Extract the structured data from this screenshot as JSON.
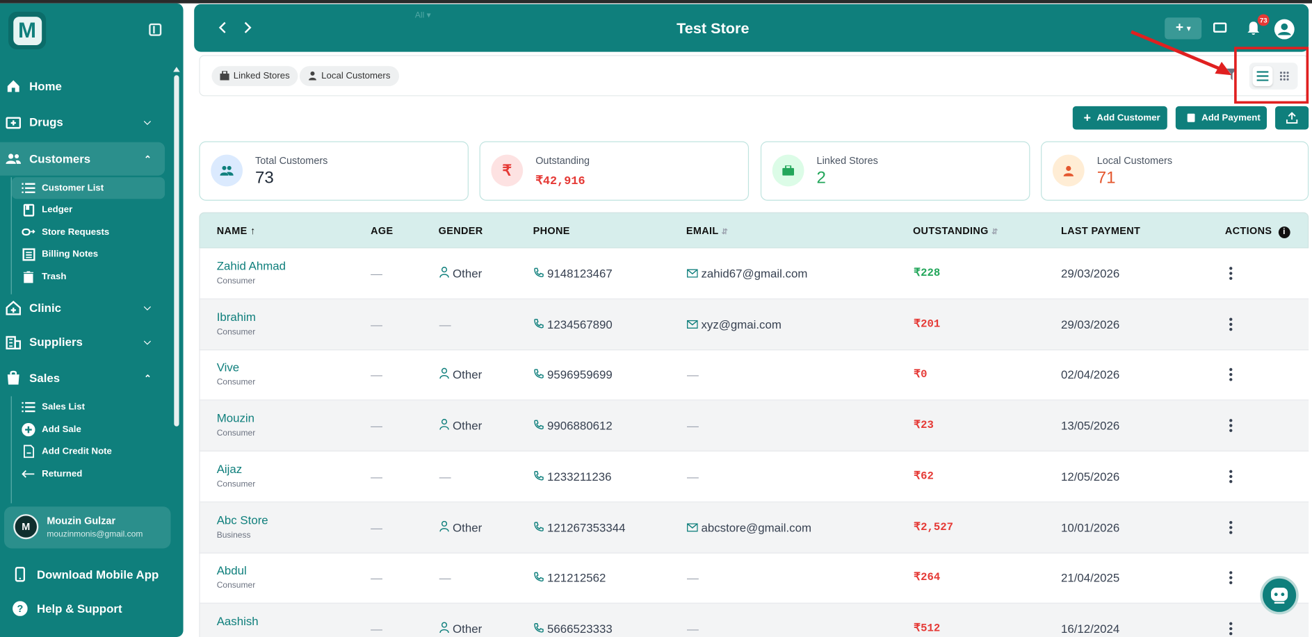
{
  "sidebar": {
    "logo_letter": "M",
    "nav": [
      {
        "label": "Home",
        "icon": "home-icon"
      },
      {
        "label": "Drugs",
        "icon": "drugs-icon"
      },
      {
        "label": "Customers",
        "icon": "customers-icon"
      },
      {
        "label": "Clinic",
        "icon": "clinic-icon"
      },
      {
        "label": "Suppliers",
        "icon": "suppliers-icon"
      },
      {
        "label": "Sales",
        "icon": "sales-icon"
      }
    ],
    "customers_sub": [
      {
        "label": "Customer List"
      },
      {
        "label": "Ledger"
      },
      {
        "label": "Store Requests"
      },
      {
        "label": "Billing Notes"
      },
      {
        "label": "Trash"
      }
    ],
    "sales_sub": [
      {
        "label": "Sales List"
      },
      {
        "label": "Add Sale"
      },
      {
        "label": "Add Credit Note"
      },
      {
        "label": "Returned"
      }
    ],
    "user": {
      "initial": "M",
      "name": "Mouzin Gulzar",
      "email": "mouzinmonis@gmail.com"
    },
    "download_app": "Download Mobile App",
    "help": "Help & Support"
  },
  "header": {
    "title": "Test Store",
    "ghost_text": "All",
    "notification_count": "73"
  },
  "filters": {
    "chips": [
      "Linked Stores",
      "Local Customers"
    ]
  },
  "actions": {
    "add_customer": "Add Customer",
    "add_payment": "Add Payment"
  },
  "stats": [
    {
      "label": "Total Customers",
      "value": "73",
      "color": "#1f2937"
    },
    {
      "label": "Outstanding",
      "value": "₹42,916",
      "color": "#e53935"
    },
    {
      "label": "Linked Stores",
      "value": "2",
      "color": "#22a65a"
    },
    {
      "label": "Local Customers",
      "value": "71",
      "color": "#e4572e"
    }
  ],
  "table": {
    "columns": [
      "NAME",
      "AGE",
      "GENDER",
      "PHONE",
      "EMAIL",
      "OUTSTANDING",
      "LAST PAYMENT",
      "ACTIONS"
    ],
    "rows": [
      {
        "name": "Zahid Ahmad",
        "type": "Consumer",
        "age": "—",
        "gender": "Other",
        "phone": "9148123467",
        "email": "zahid67@gmail.com",
        "outstanding": "₹228",
        "last_payment": "29/03/2026"
      },
      {
        "name": "Ibrahim",
        "type": "Consumer",
        "age": "—",
        "gender": "—",
        "phone": "1234567890",
        "email": "xyz@gmai.com",
        "outstanding": "₹201",
        "last_payment": "29/03/2026"
      },
      {
        "name": "Vive",
        "type": "Consumer",
        "age": "—",
        "gender": "Other",
        "phone": "9596959699",
        "email": "—",
        "outstanding": "₹0",
        "last_payment": "02/04/2026"
      },
      {
        "name": "Mouzin",
        "type": "Consumer",
        "age": "—",
        "gender": "Other",
        "phone": "9906880612",
        "email": "—",
        "outstanding": "₹23",
        "last_payment": "13/05/2026"
      },
      {
        "name": "Aijaz",
        "type": "Consumer",
        "age": "—",
        "gender": "—",
        "phone": "1233211236",
        "email": "—",
        "outstanding": "₹62",
        "last_payment": "12/05/2026"
      },
      {
        "name": "Abc Store",
        "type": "Business",
        "age": "—",
        "gender": "Other",
        "phone": "121267353344",
        "email": "abcstore@gmail.com",
        "outstanding": "₹2,527",
        "last_payment": "10/01/2026"
      },
      {
        "name": "Abdul",
        "type": "Consumer",
        "age": "—",
        "gender": "—",
        "phone": "121212562",
        "email": "—",
        "outstanding": "₹264",
        "last_payment": "21/04/2025"
      },
      {
        "name": "Aashish",
        "type": "",
        "age": "—",
        "gender": "Other",
        "phone": "5666523333",
        "email": "—",
        "outstanding": "₹512",
        "last_payment": "16/12/2024"
      }
    ]
  },
  "colors": {
    "primary": "#0f7f7c",
    "danger": "#e53935",
    "success": "#22a65a"
  }
}
